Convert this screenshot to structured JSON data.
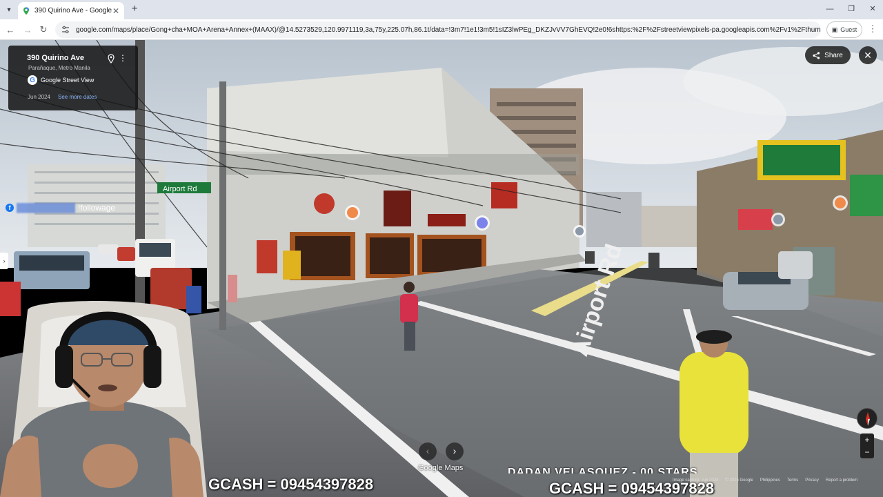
{
  "browser": {
    "tab_title": "390 Quirino Ave - Google Maps",
    "url": "google.com/maps/place/Gong+cha+MOA+Arena+Annex+(MAAX)/@14.5273529,120.9971119,3a,75y,225.07h,86.1t/data=!3m7!1e1!3m5!1sIZ3lwPEg_DKZJvVV7GhEVQ!2e0!6shttps:%2F%2Fstreetviewpixels-pa.googleapis.com%2Fv1%2Fthumbnail%3Fcb_client%...",
    "profile_label": "Guest",
    "icons": [
      "tab-list-icon",
      "maps-pin-favicon",
      "close-icon",
      "new-tab-icon",
      "minimize-icon",
      "restore-icon",
      "window-close-icon",
      "back-icon",
      "forward-icon",
      "reload-icon",
      "site-settings-icon",
      "profile-icon",
      "menu-icon"
    ]
  },
  "street_view": {
    "address": "390 Quirino Ave",
    "locality": "Parañaque, Metro Manila",
    "source_label": "Google Street View",
    "capture_date": "Jun 2024",
    "see_more_dates": "See more dates",
    "share_label": "Share",
    "brand_logo": "Google Maps",
    "road_sign": "Airport Rd",
    "road_marking": "Airport Rd",
    "footer": {
      "image_capture": "Image capture: Jun 2024",
      "copyright": "© 2025 Google",
      "region": "Philippines",
      "terms": "Terms",
      "privacy": "Privacy",
      "report": "Report a problem"
    }
  },
  "stream_overlay": {
    "follow_text": "!followage",
    "gcash_left": "GCASH = 09454397828",
    "gcash_right": "GCASH = 09454397828",
    "ticker_text": "DADAN VELASQUEZ - 00 STARS"
  },
  "colors": {
    "chrome_tab_bg": "#dfe3eb",
    "link_blue": "#8ab4f8",
    "sky": "#c9d3dc",
    "road": "#6e7276",
    "shirt_yellow": "#e8e23a"
  }
}
